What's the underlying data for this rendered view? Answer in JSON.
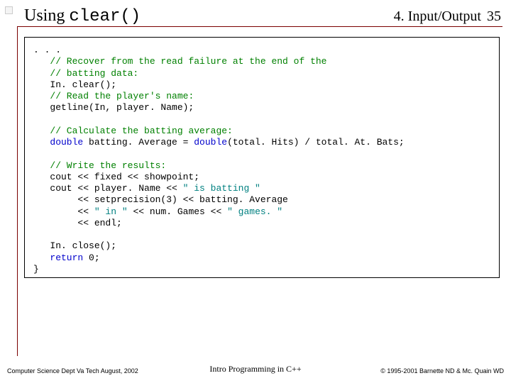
{
  "header": {
    "title_plain": "Using ",
    "title_mono": "clear()",
    "chapter": "4. Input/Output",
    "page_number": "35"
  },
  "code": {
    "l0": ". . .",
    "l1a": "   ",
    "l1b": "// Recover from the read failure at the end of the",
    "l2a": "   ",
    "l2b": "// batting data:",
    "l3": "   In. clear();",
    "l4a": "   ",
    "l4b": "// Read the player's name:",
    "l5": "   getline(In, player. Name);",
    "blank1": "",
    "l6a": "   ",
    "l6b": "// Calculate the batting average:",
    "l7a": "   ",
    "l7b": "double",
    "l7c": " batting. Average = ",
    "l7d": "double",
    "l7e": "(total. Hits) / total. At. Bats;",
    "blank2": "",
    "l8a": "   ",
    "l8b": "// Write the results:",
    "l9": "   cout << fixed << showpoint;",
    "l10a": "   cout << player. Name << ",
    "l10b": "\" is batting \"",
    "l11a": "        << setprecision(3) << batting. Average",
    "l12a": "        << ",
    "l12b": "\" in \"",
    "l12c": " << num. Games << ",
    "l12d": "\" games. \"",
    "l13": "        << endl;",
    "blank3": "",
    "l14": "   In. close();",
    "l15a": "   ",
    "l15b": "return",
    "l15c": " 0;",
    "l16": "}"
  },
  "footer": {
    "left": "Computer Science Dept Va Tech  August, 2002",
    "center": "Intro Programming in C++",
    "right": "© 1995-2001  Barnette ND & Mc. Quain WD"
  }
}
